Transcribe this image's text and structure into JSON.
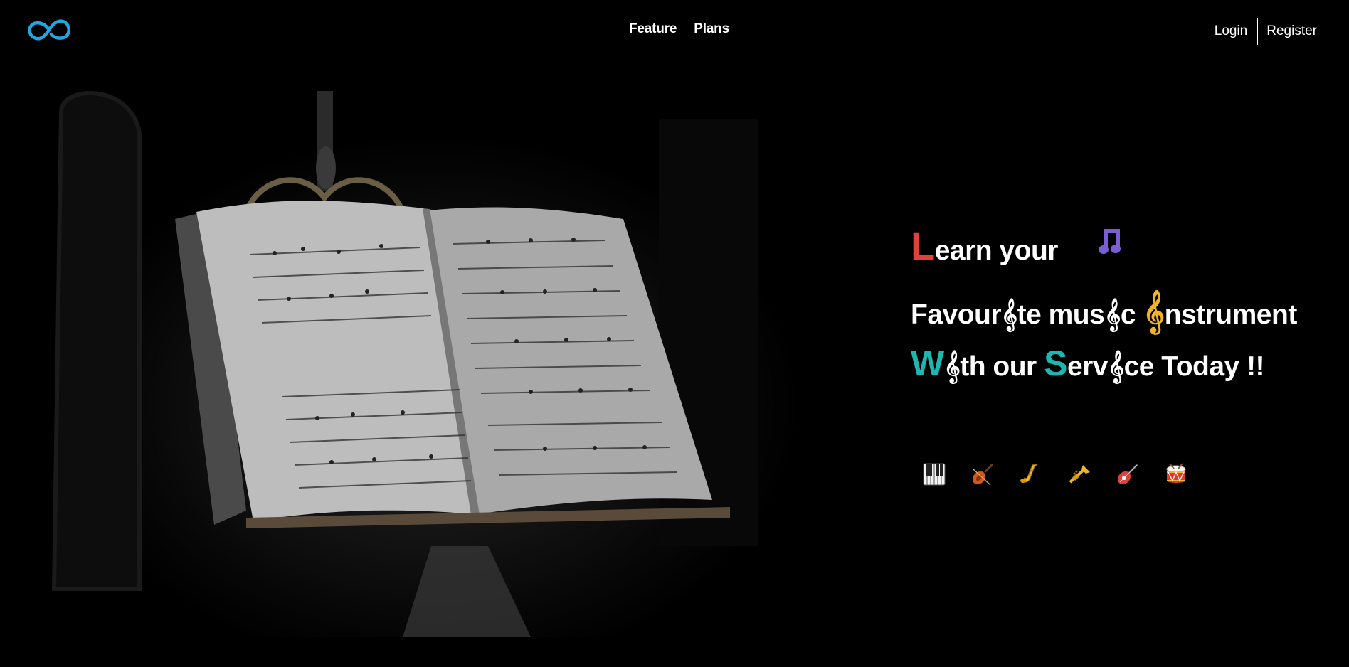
{
  "nav": {
    "logo_icon": "infinity-icon",
    "links": [
      "Feature",
      "Plans"
    ],
    "login": "Login",
    "register": "Register"
  },
  "hero": {
    "image": "sheet-music-book-on-stand",
    "headline": {
      "line1_initial": "L",
      "line1_rest": "earn your",
      "line1_icon": "music-notes-icon",
      "line2_a": "Favour",
      "line2_b": "te mus",
      "line2_c": "c ",
      "line2_d": "nstrument",
      "line3_initial": "W",
      "line3_a": "th our ",
      "line3_initial2": "S",
      "line3_b": "erv",
      "line3_c": "ce Today !!",
      "clef_glyph": "𝄞"
    },
    "instruments": [
      "piano-icon",
      "violin-icon",
      "saxophone-icon",
      "trumpet-icon",
      "guitar-icon",
      "drum-icon"
    ]
  },
  "colors": {
    "logo": "#1ea7e1",
    "accent_red": "#e2413b",
    "accent_teal": "#1bb7b0",
    "accent_gold": "#f0b428",
    "notes_purple": "#7b5ed6"
  }
}
